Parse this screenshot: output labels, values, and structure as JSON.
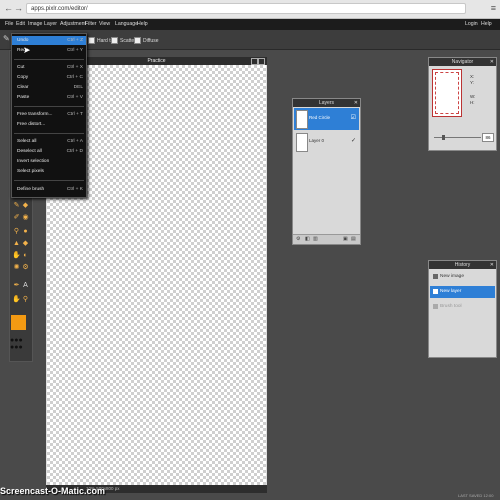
{
  "browser": {
    "url": "apps.pixlr.com/editor/",
    "back": "←",
    "forward": "→",
    "menu_icon": "≡"
  },
  "menubar": {
    "items": [
      "File",
      "Edit",
      "Image",
      "Layer",
      "Adjustment",
      "Filter",
      "View",
      "Language",
      "Help"
    ],
    "right": [
      "Login",
      "Help"
    ]
  },
  "options": {
    "hard_tip": "Hard tip",
    "scatter": "Scatter",
    "diffuse": "Diffuse"
  },
  "edit_menu": {
    "items": [
      {
        "label": "Undo",
        "shortcut": "Ctrl + Z"
      },
      {
        "label": "Redo",
        "shortcut": "Ctrl + Y"
      },
      {
        "label": "Cut",
        "shortcut": "Ctrl + X"
      },
      {
        "label": "Copy",
        "shortcut": "Ctrl + C"
      },
      {
        "label": "Clear",
        "shortcut": "DEL"
      },
      {
        "label": "Paste",
        "shortcut": "Ctrl + V"
      },
      {
        "label": "Free transform...",
        "shortcut": "Ctrl + T"
      },
      {
        "label": "Free distort...",
        "shortcut": ""
      },
      {
        "label": "Select all",
        "shortcut": "Ctrl + A"
      },
      {
        "label": "Deselect all",
        "shortcut": "Ctrl + D"
      },
      {
        "label": "Invert selection",
        "shortcut": ""
      },
      {
        "label": "Select pixels",
        "shortcut": ""
      },
      {
        "label": "Define brush",
        "shortcut": "Ctrl + K"
      }
    ]
  },
  "canvas": {
    "title": "Practice",
    "status": "10% 500x800 px"
  },
  "layers": {
    "title": "Layers",
    "items": [
      {
        "name": "Red Circle",
        "selected": true
      },
      {
        "name": "Layer 0",
        "selected": false
      }
    ]
  },
  "navigator": {
    "title": "Navigator",
    "x_label": "X:",
    "y_label": "Y:",
    "w_label": "W:",
    "h_label": "H:",
    "zoom": "86"
  },
  "history": {
    "title": "History",
    "items": [
      {
        "label": "New image",
        "state": "normal"
      },
      {
        "label": "New layer",
        "state": "selected"
      },
      {
        "label": "Brush tool",
        "state": "disabled"
      }
    ]
  },
  "watermark": "Screencast-O-Matic.com",
  "footer_right": "LAST SAVED 12:00",
  "colors": {
    "accent": "#2e7fd6",
    "swatch": "#f39a13",
    "dark": "#1c1c1c"
  }
}
